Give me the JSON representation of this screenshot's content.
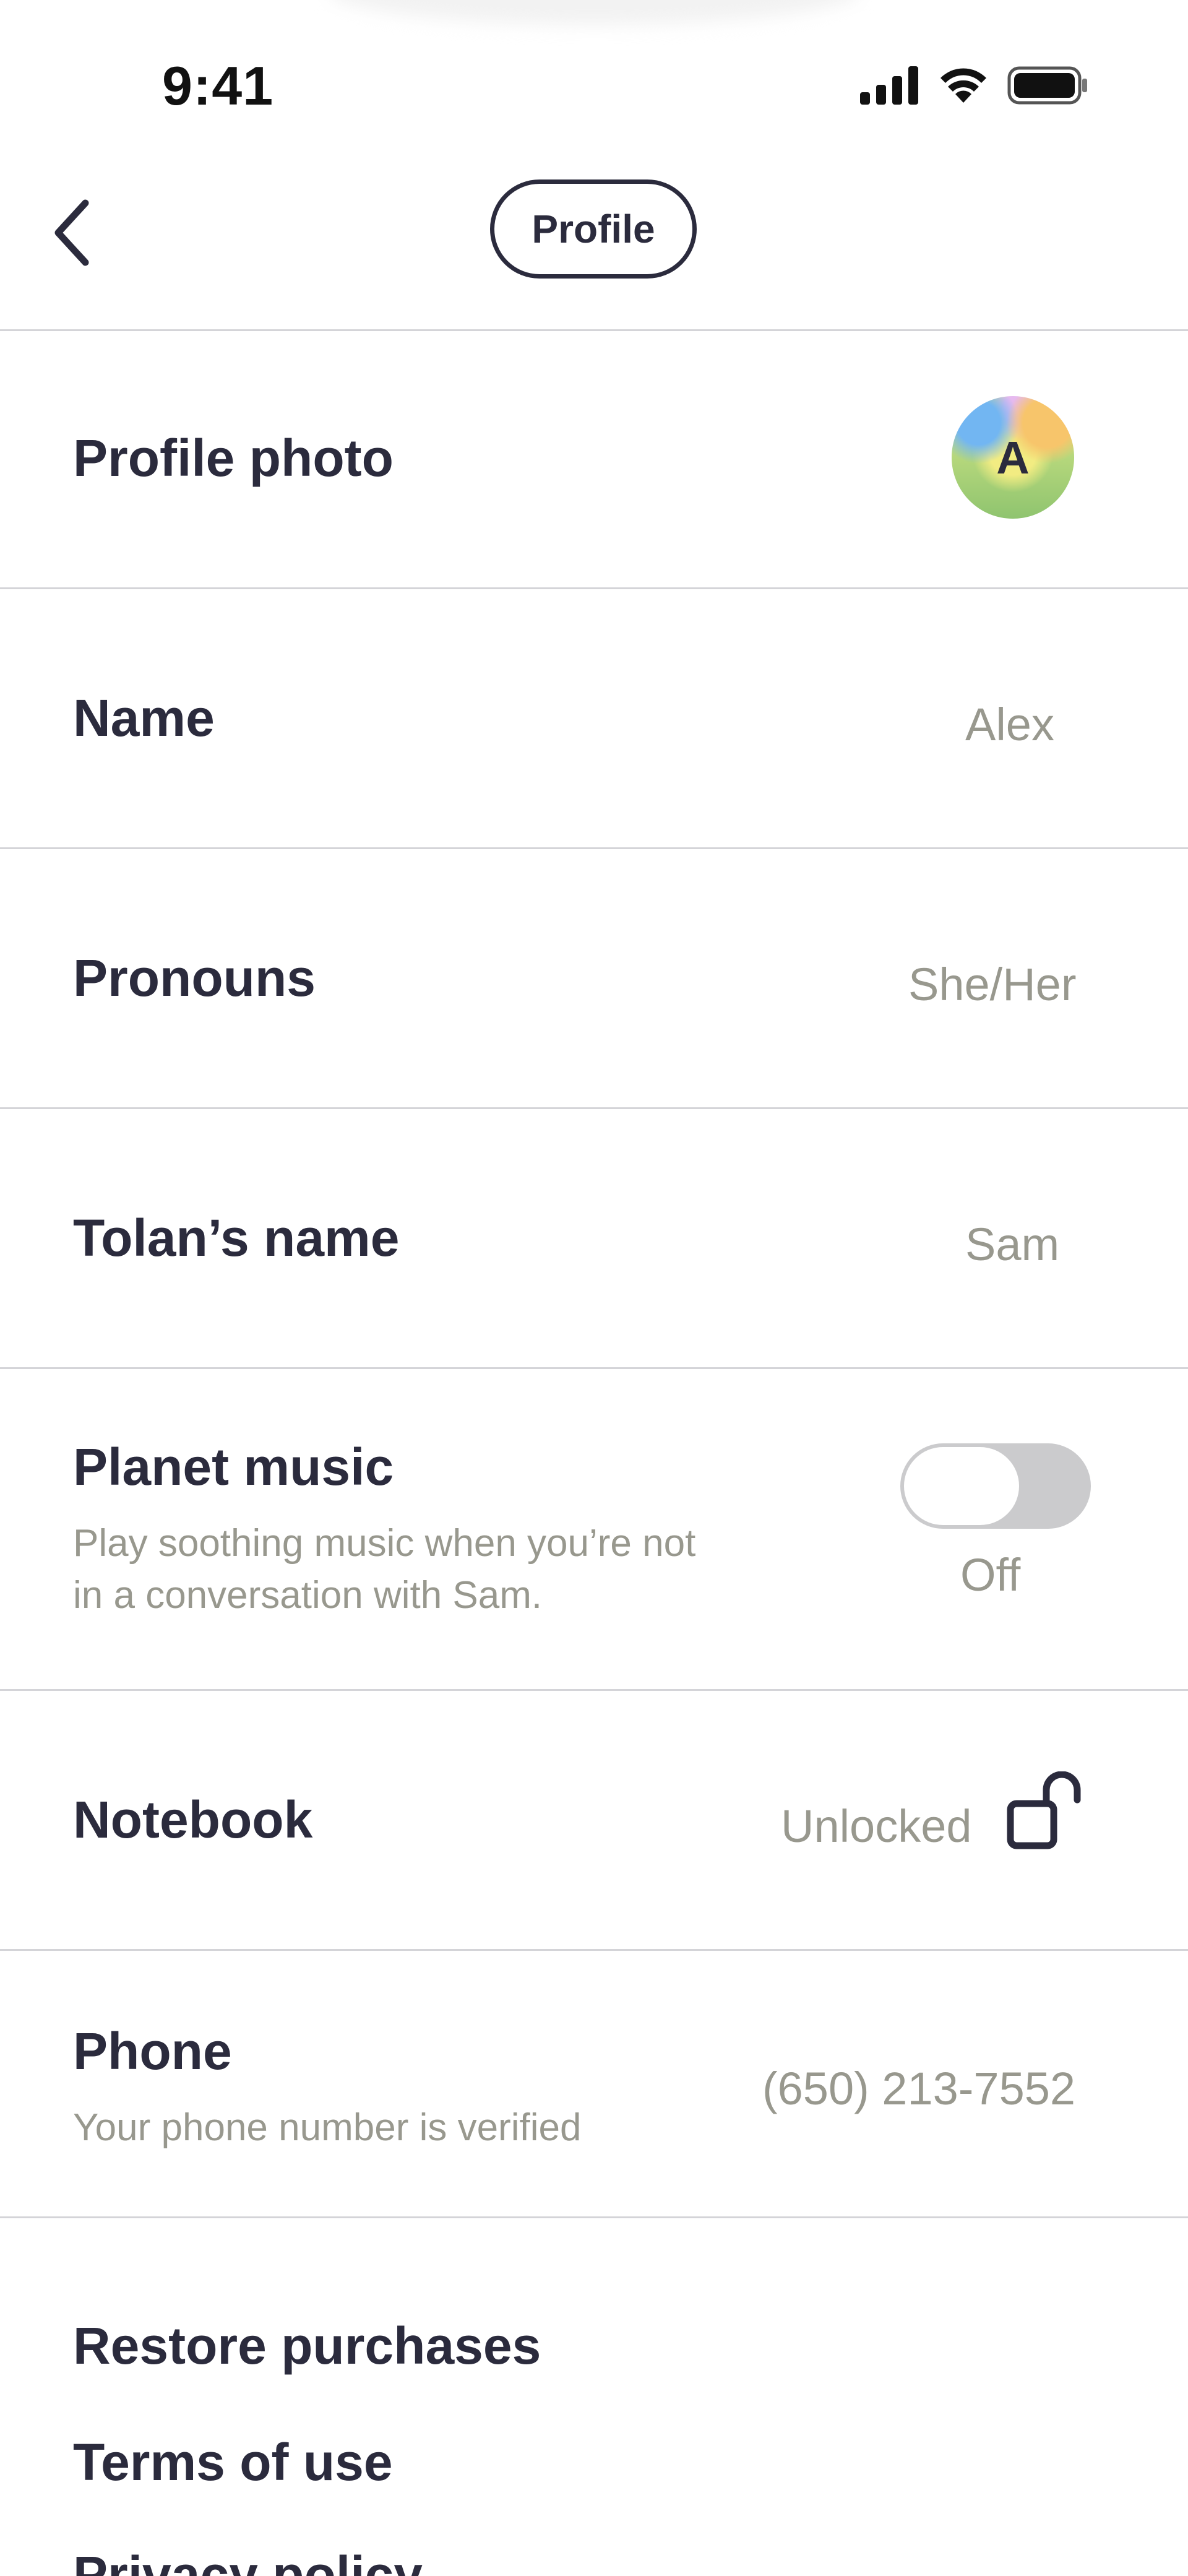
{
  "status_bar": {
    "time": "9:41",
    "icons": [
      "signal-icon",
      "wifi-icon",
      "battery-icon"
    ]
  },
  "header": {
    "title": "Profile",
    "back_icon": "chevron-left-icon"
  },
  "rows": {
    "profile_photo": {
      "label": "Profile photo",
      "avatar_initial": "A"
    },
    "name": {
      "label": "Name",
      "value": "Alex"
    },
    "pronouns": {
      "label": "Pronouns",
      "value": "She/Her"
    },
    "tolan_name": {
      "label": "Tolan’s name",
      "value": "Sam"
    },
    "planet_music": {
      "label": "Planet music",
      "desc_line1": "Play soothing music when you’re not",
      "desc_line2": "in a conversation with Sam.",
      "state": "Off",
      "enabled": false
    },
    "notebook": {
      "label": "Notebook",
      "value": "Unlocked",
      "icon": "unlocked-padlock-icon"
    },
    "phone": {
      "label": "Phone",
      "desc": "Your phone number is verified",
      "value": "(650) 213-7552"
    }
  },
  "links": [
    "Restore purchases",
    "Terms of use",
    "Privacy policy"
  ],
  "colors": {
    "text": "#2b2b3d",
    "muted": "#98988e",
    "divider": "#d4d4d8",
    "toggle_off": "#cbcbcd"
  }
}
